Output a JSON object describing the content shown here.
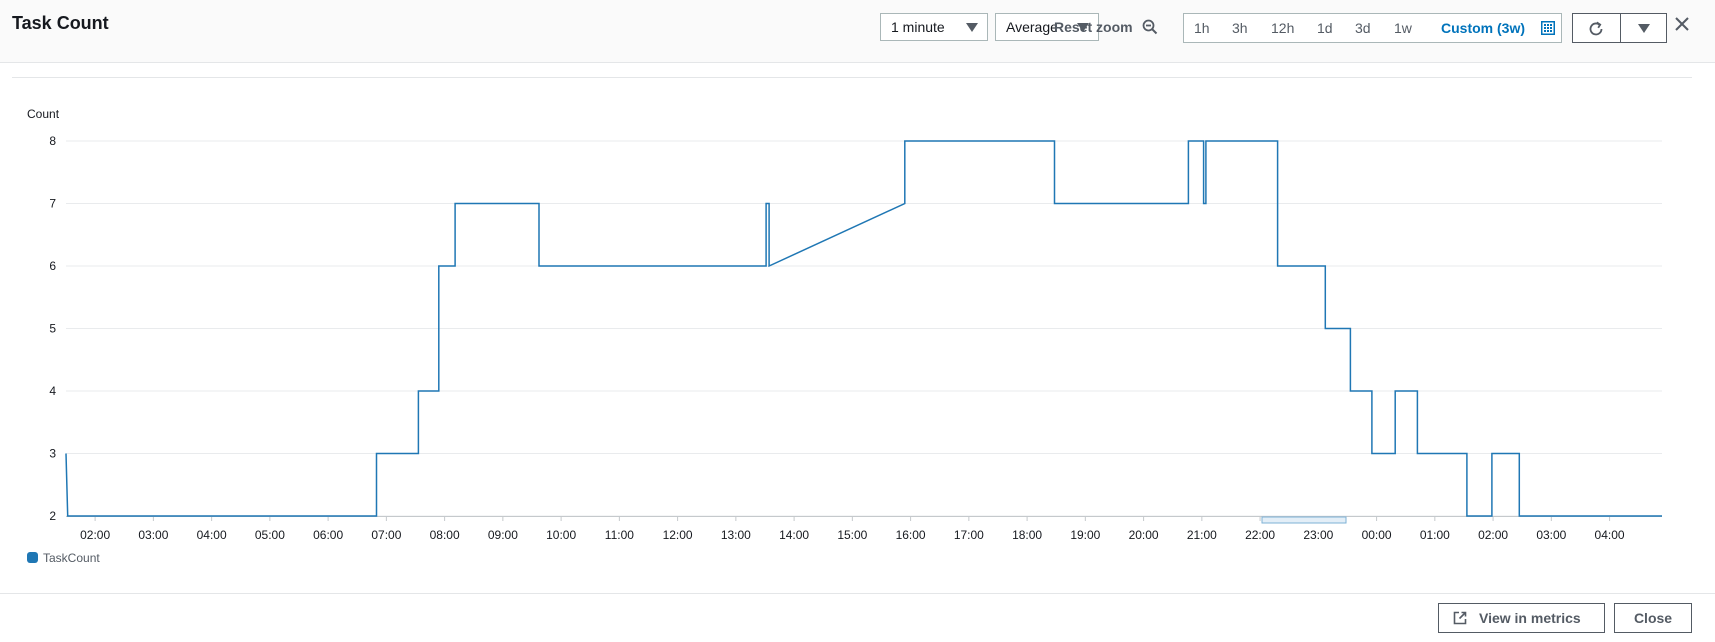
{
  "header": {
    "title": "Task Count",
    "period": "1 minute",
    "statistic": "Average",
    "reset_zoom": "Reset zoom",
    "ranges": [
      "1h",
      "3h",
      "12h",
      "1d",
      "3d",
      "1w"
    ],
    "custom_range": "Custom (3w)"
  },
  "footer": {
    "view_in_metrics": "View in metrics",
    "close": "Close"
  },
  "colors": {
    "series": "#1f77b4",
    "accent": "#0073bb"
  },
  "chart_data": {
    "type": "line",
    "ylabel": "Count",
    "ylim": [
      2,
      8
    ],
    "yticks": [
      2,
      3,
      4,
      5,
      6,
      7,
      8
    ],
    "grid": true,
    "legend": "bottom-left",
    "xlim": [
      1.5,
      28.9
    ],
    "x_tick_labels": [
      "02:00",
      "03:00",
      "04:00",
      "05:00",
      "06:00",
      "07:00",
      "08:00",
      "09:00",
      "10:00",
      "11:00",
      "12:00",
      "13:00",
      "14:00",
      "15:00",
      "16:00",
      "17:00",
      "18:00",
      "19:00",
      "20:00",
      "21:00",
      "22:00",
      "23:00",
      "00:00",
      "01:00",
      "02:00",
      "03:00",
      "04:00"
    ],
    "x_tick_hours": [
      2,
      3,
      4,
      5,
      6,
      7,
      8,
      9,
      10,
      11,
      12,
      13,
      14,
      15,
      16,
      17,
      18,
      19,
      20,
      21,
      22,
      23,
      24,
      25,
      26,
      27,
      28
    ],
    "series": [
      {
        "name": "TaskCount",
        "x": [
          1.5,
          1.53,
          6.83,
          6.83,
          7.55,
          7.55,
          7.9,
          7.9,
          8.18,
          8.18,
          9.62,
          9.62,
          13.52,
          13.52,
          13.57,
          13.57,
          15.9,
          15.9,
          18.47,
          18.47,
          20.77,
          20.77,
          21.03,
          21.03,
          21.07,
          21.07,
          22.3,
          22.3,
          23.12,
          23.12,
          23.55,
          23.55,
          23.92,
          23.92,
          24.32,
          24.32,
          24.7,
          24.7,
          25.55,
          25.55,
          25.98,
          25.98,
          26.45,
          26.45,
          28.9
        ],
        "y": [
          3,
          2,
          2,
          3,
          3,
          4,
          4,
          6,
          6,
          7,
          7,
          6,
          6,
          7,
          7,
          6,
          7,
          8,
          8,
          7,
          7,
          8,
          8,
          7,
          7,
          8,
          8,
          6,
          6,
          5,
          5,
          4,
          4,
          3,
          3,
          4,
          4,
          3,
          3,
          2,
          2,
          3,
          3,
          2,
          2
        ]
      }
    ]
  }
}
